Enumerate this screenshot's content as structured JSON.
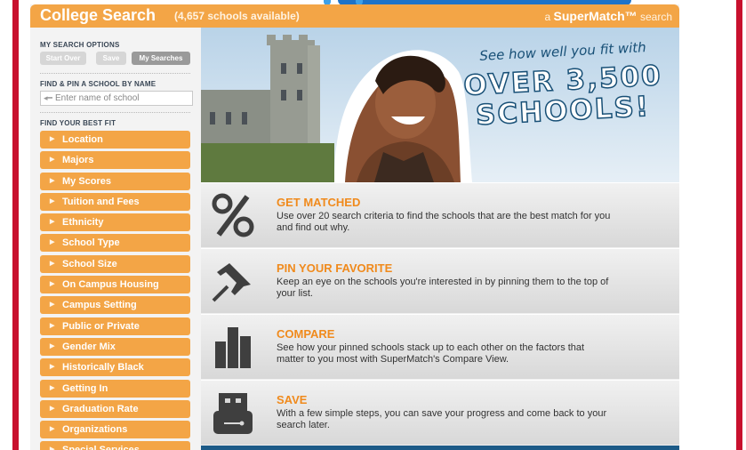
{
  "header": {
    "title": "College Search",
    "count": "(4,657 schools available)",
    "brand_prefix": "a",
    "brand_name": "SuperMatch™",
    "brand_suffix": "search"
  },
  "sidebar": {
    "search_options_label": "MY SEARCH OPTIONS",
    "buttons": {
      "start_over": "Start Over",
      "save": "Save",
      "my_searches": "My Searches"
    },
    "find_pin_label": "FIND & PIN A SCHOOL BY NAME",
    "school_input_placeholder": "Enter name of school",
    "best_fit_label": "FIND YOUR BEST FIT",
    "fit_items": [
      "Location",
      "Majors",
      "My Scores",
      "Tuition and Fees",
      "Ethnicity",
      "School Type",
      "School Size",
      "On Campus Housing",
      "Campus Setting",
      "Public or Private",
      "Gender Mix",
      "Historically Black",
      "Getting In",
      "Graduation Rate",
      "Organizations",
      "Special Services"
    ]
  },
  "hero": {
    "line1": "See how well you fit with",
    "line2": "OVER 3,500",
    "line3": "SCHOOLS!"
  },
  "features": [
    {
      "title": "GET MATCHED",
      "desc": "Use over 20 search criteria to find the schools that are the best match for you and find out why.",
      "icon": "percent-icon"
    },
    {
      "title": "PIN YOUR FAVORITE",
      "desc": "Keep an eye on the schools you're interested in by pinning them to the top of your list.",
      "icon": "pushpin-icon"
    },
    {
      "title": "COMPARE",
      "desc": "See how your pinned schools stack up to each other on the factors that matter to you most with SuperMatch's Compare View.",
      "icon": "bar-chart-icon"
    },
    {
      "title": "SAVE",
      "desc": "With a few simple steps, you can save your progress and come back to your search later.",
      "icon": "usb-drive-icon"
    }
  ],
  "colors": {
    "accent": "#f3a546",
    "feature_title": "#f08a1c",
    "frame_red": "#c8102e"
  }
}
